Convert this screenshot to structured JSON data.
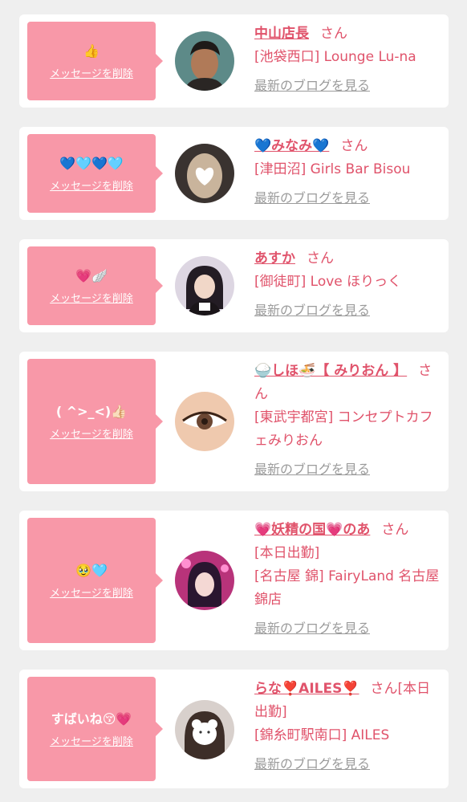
{
  "delete_label": "メッセージを削除",
  "blog_label": "最新のブログを見る",
  "san_label": "さん",
  "items": [
    {
      "message": "👍",
      "name": "中山店長",
      "lines": [
        "[池袋西口] Lounge Lu-na"
      ]
    },
    {
      "message": "💙🩵💙🩵",
      "name": "💙みなみ💙",
      "lines": [
        "[津田沼] Girls Bar Bisou"
      ]
    },
    {
      "message": "💗🪽",
      "name": "あすか",
      "lines": [
        "[御徒町] Love ほりっく"
      ]
    },
    {
      "message": "( ^>_<)👍🏻",
      "name": "🍚しほ🍜【 みりおん 】",
      "lines": [
        "[東武宇都宮] コンセプトカフェみりおん"
      ]
    },
    {
      "message": "🥹🩵",
      "name": "💗妖精の国💗のあ",
      "lines": [
        "[本日出勤]",
        "[名古屋 錦] FairyLand 名古屋錦店"
      ]
    },
    {
      "message": "すばいね😚💗",
      "name": "らな❣️AILES❣️",
      "lines": [
        "[本日出勤]",
        "[錦糸町駅南口] AILES"
      ]
    }
  ]
}
